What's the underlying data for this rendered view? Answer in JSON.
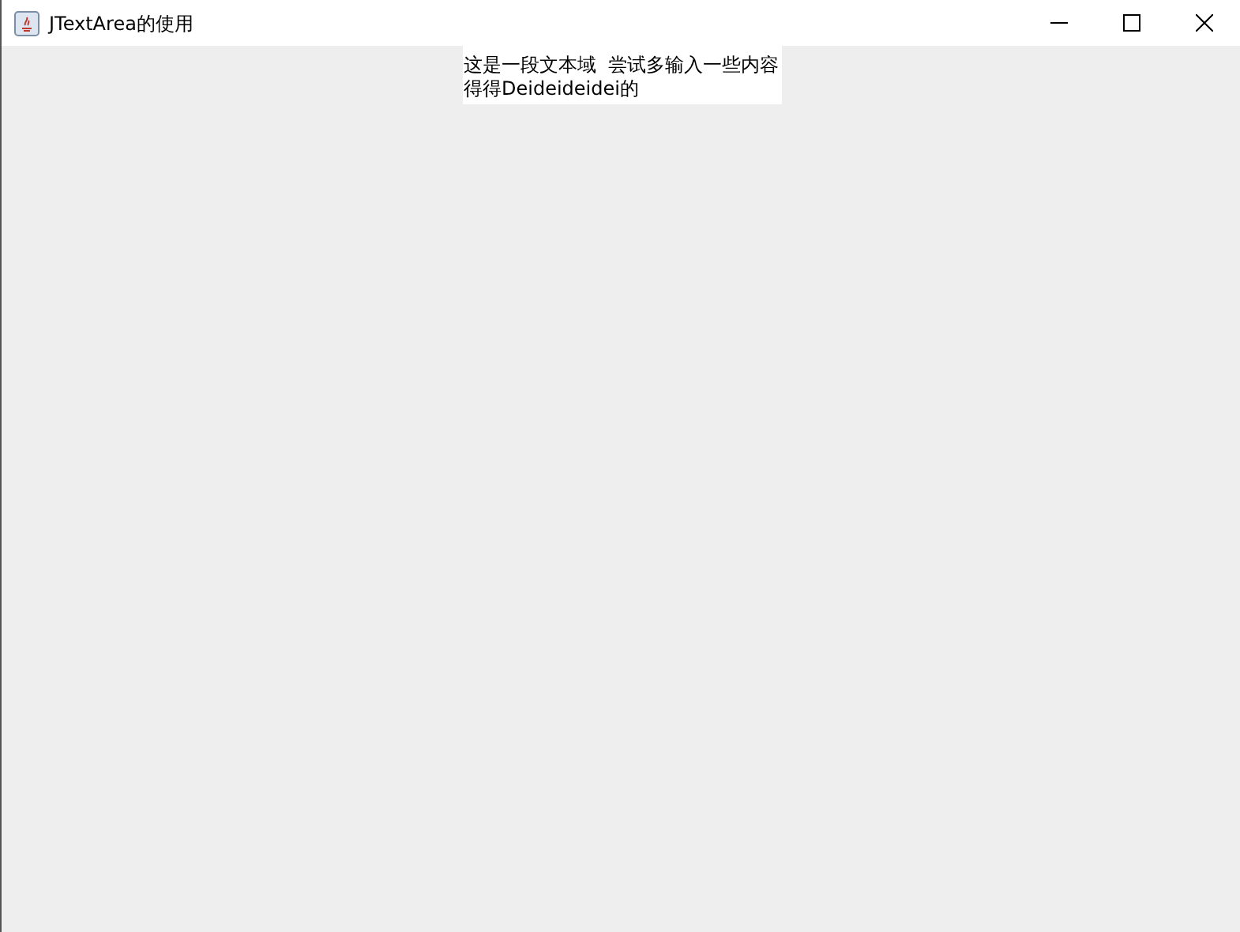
{
  "window": {
    "title": "JTextArea的使用"
  },
  "text_area": {
    "lines": [
      "这是一段文本域  尝试多输入一些内容",
      "得得Deideideidei的"
    ]
  }
}
